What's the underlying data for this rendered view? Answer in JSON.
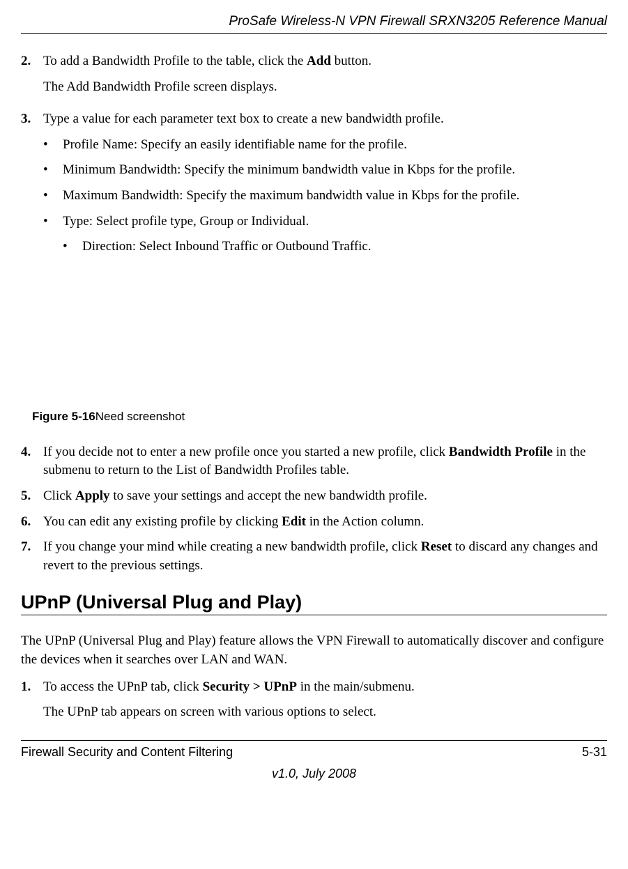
{
  "header": {
    "title": "ProSafe Wireless-N VPN Firewall SRXN3205 Reference Manual"
  },
  "steps_first": [
    {
      "number": "2.",
      "text_before": "To add a Bandwidth Profile to the table, click the ",
      "bold": "Add",
      "text_after": " button.",
      "sub": "The Add Bandwidth Profile screen displays."
    },
    {
      "number": "3.",
      "text_before": "Type a value for each parameter text box to create a new bandwidth profile.",
      "bold": "",
      "text_after": "",
      "sub": ""
    }
  ],
  "bullets": [
    "Profile Name: Specify an easily identifiable name for the profile.",
    "Minimum Bandwidth: Specify the minimum bandwidth value in Kbps for the profile.",
    "Maximum Bandwidth: Specify the maximum bandwidth value in Kbps for the profile.",
    "Type: Select profile type, Group or Individual."
  ],
  "nested_bullet": "Direction: Select Inbound Traffic or Outbound Traffic.",
  "figure": {
    "label": "Figure 5-16",
    "note": "Need screenshot"
  },
  "steps_second": [
    {
      "number": "4.",
      "parts": [
        {
          "t": "If you decide not to enter a new profile once you started a new profile, click "
        },
        {
          "b": "Bandwidth Profile"
        },
        {
          "t": " in the submenu to return to the List of Bandwidth Profiles table."
        }
      ]
    },
    {
      "number": "5.",
      "parts": [
        {
          "t": "Click "
        },
        {
          "b": "Apply"
        },
        {
          "t": " to save your settings and accept the new bandwidth profile."
        }
      ]
    },
    {
      "number": "6.",
      "parts": [
        {
          "t": "You can edit any existing profile by clicking "
        },
        {
          "b": "Edit"
        },
        {
          "t": " in the Action column."
        }
      ]
    },
    {
      "number": "7.",
      "parts": [
        {
          "t": "If you change your mind while creating a new bandwidth profile, click "
        },
        {
          "b": "Reset"
        },
        {
          "t": " to discard any changes and revert to the previous settings."
        }
      ]
    }
  ],
  "section": {
    "title": "UPnP (Universal Plug and Play)"
  },
  "upnp_intro": "The UPnP (Universal Plug and Play) feature allows the VPN Firewall to automatically discover and configure the devices when it searches over LAN and WAN.",
  "upnp_step": {
    "number": "1.",
    "parts": [
      {
        "t": "To access the UPnP tab, click "
      },
      {
        "b": "Security > UPnP"
      },
      {
        "t": " in the main/submenu."
      }
    ],
    "sub": "The UPnP tab appears on screen with various options to select."
  },
  "footer": {
    "left": "Firewall Security and Content Filtering",
    "right": "5-31",
    "center": "v1.0, July 2008"
  }
}
